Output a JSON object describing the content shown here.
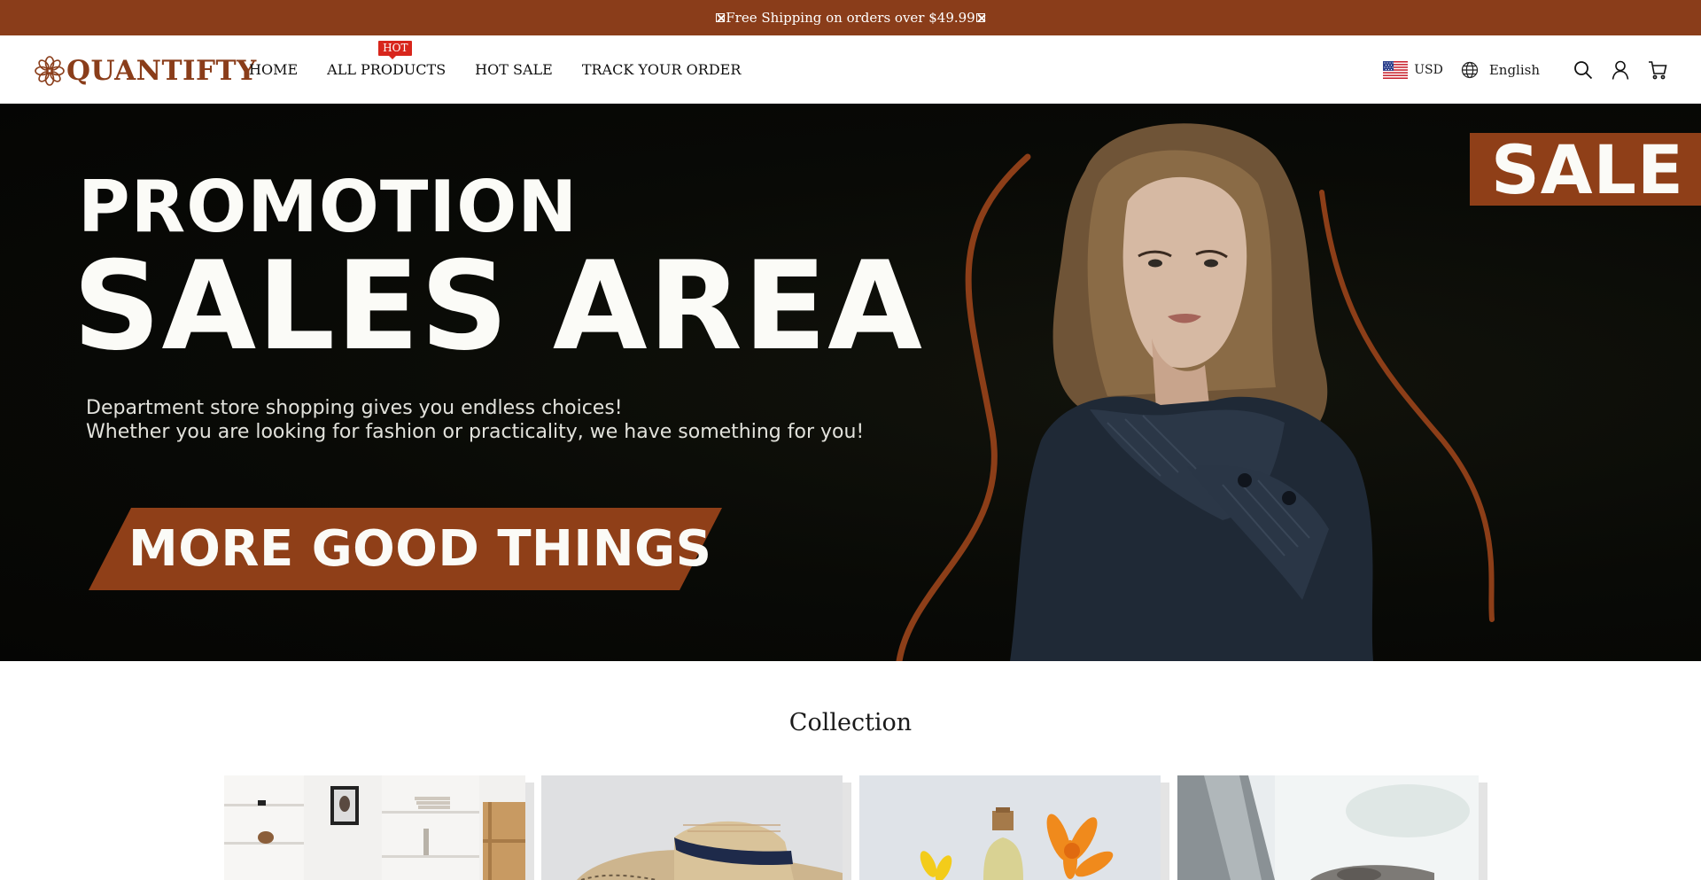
{
  "announcement": {
    "text": "Free Shipping on orders over $49.99"
  },
  "brand": {
    "name": "QUANTIFTY",
    "accent_color": "#8a3d1a"
  },
  "nav": {
    "items": [
      {
        "label": "HOME"
      },
      {
        "label": "ALL PRODUCTS",
        "badge": "HOT"
      },
      {
        "label": "HOT SALE"
      },
      {
        "label": "TRACK YOUR ORDER"
      }
    ]
  },
  "tools": {
    "currency": "USD",
    "language": "English",
    "icons": [
      "us-flag-icon",
      "globe-icon",
      "search-icon",
      "account-icon",
      "cart-icon"
    ]
  },
  "hero": {
    "line1": "PROMOTION",
    "line2": "SALES AREA",
    "desc1": "Department store shopping gives you endless choices!",
    "desc2": "Whether you are looking for fashion or practicality, we have something for you!",
    "cta": "MORE GOOD THINGS",
    "sale": "SALE"
  },
  "collection": {
    "title": "Collection"
  }
}
